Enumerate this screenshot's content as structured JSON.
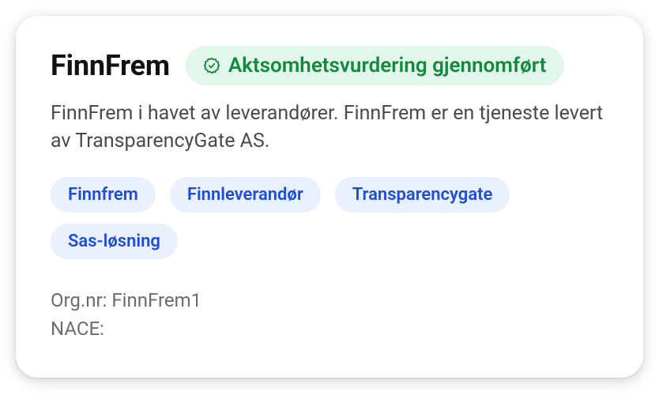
{
  "card": {
    "title": "FinnFrem",
    "badge": {
      "label": "Aktsomhetsvurdering gjennomført",
      "icon": "check-badge-icon"
    },
    "description": "FinnFrem i havet av leverandører. FinnFrem er en tjeneste levert av TransparencyGate AS.",
    "tags": [
      "Finnfrem",
      "Finnleverandør",
      "Transparencygate",
      "Sas-løsning"
    ],
    "meta": {
      "orgnr_label": "Org.nr:",
      "orgnr_value": "FinnFrem1",
      "nace_label": "NACE:",
      "nace_value": ""
    }
  }
}
